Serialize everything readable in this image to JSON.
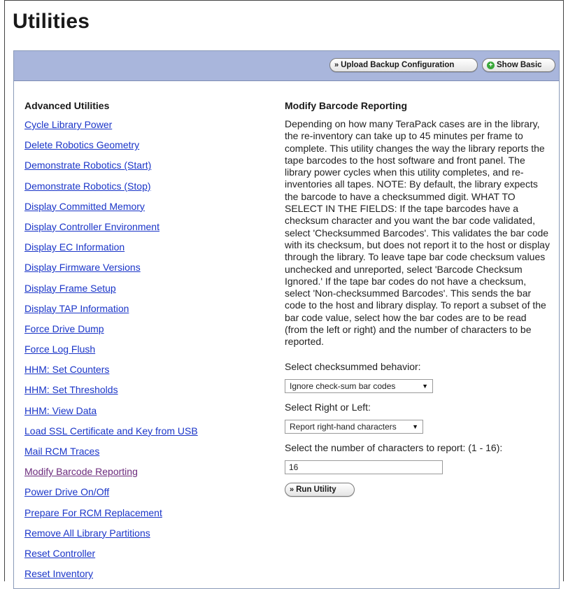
{
  "page": {
    "title": "Utilities"
  },
  "toolbar": {
    "upload_label": "Upload Backup Configuration",
    "show_basic_label": "Show Basic"
  },
  "sidebar": {
    "heading": "Advanced Utilities",
    "items": [
      {
        "label": "Cycle Library Power"
      },
      {
        "label": "Delete Robotics Geometry"
      },
      {
        "label": "Demonstrate Robotics (Start)"
      },
      {
        "label": "Demonstrate Robotics (Stop)"
      },
      {
        "label": "Display Committed Memory"
      },
      {
        "label": "Display Controller Environment"
      },
      {
        "label": "Display EC Information"
      },
      {
        "label": "Display Firmware Versions"
      },
      {
        "label": "Display Frame Setup"
      },
      {
        "label": "Display TAP Information"
      },
      {
        "label": "Force Drive Dump"
      },
      {
        "label": "Force Log Flush"
      },
      {
        "label": "HHM: Set Counters"
      },
      {
        "label": "HHM: Set Thresholds"
      },
      {
        "label": "HHM: View Data"
      },
      {
        "label": "Load SSL Certificate and Key from USB"
      },
      {
        "label": "Mail RCM Traces"
      },
      {
        "label": "Modify Barcode Reporting"
      },
      {
        "label": "Power Drive On/Off"
      },
      {
        "label": "Prepare For RCM Replacement"
      },
      {
        "label": "Remove All Library Partitions"
      },
      {
        "label": "Reset Controller"
      },
      {
        "label": "Reset Inventory"
      }
    ]
  },
  "detail": {
    "heading": "Modify Barcode Reporting",
    "description": "Depending on how many TeraPack cases are in the library, the re-inventory can take up to 45 minutes per frame to complete. This utility changes the way the library reports the tape barcodes to the host software and front panel. The library power cycles when this utility completes, and re-inventories all tapes. NOTE: By default, the library expects the barcode to have a checksummed digit. WHAT TO SELECT IN THE FIELDS: If the tape barcodes have a checksum character and you want the bar code validated, select 'Checksummed Barcodes'. This validates the bar code with its checksum, but does not report it to the host or display through the library. To leave tape bar code checksum values unchecked and unreported, select 'Barcode Checksum Ignored.' If the tape bar codes do not have a checksum, select 'Non-checksummed Barcodes'. This sends the bar code to the host and library display. To report a subset of the bar code value, select how the bar codes are to be read (from the left or right) and the number of characters to be reported.",
    "checksum_label": "Select checksummed behavior:",
    "checksum_value": "Ignore check-sum bar codes",
    "side_label": "Select Right or Left:",
    "side_value": "Report right-hand characters",
    "count_label": "Select the number of characters to report: (1 - 16):",
    "count_value": "16",
    "run_label": "Run Utility"
  },
  "colors": {
    "toolbar_bg": "#a9b6dc",
    "link": "#1a35c8",
    "visited_link": "#6b2a7b"
  }
}
